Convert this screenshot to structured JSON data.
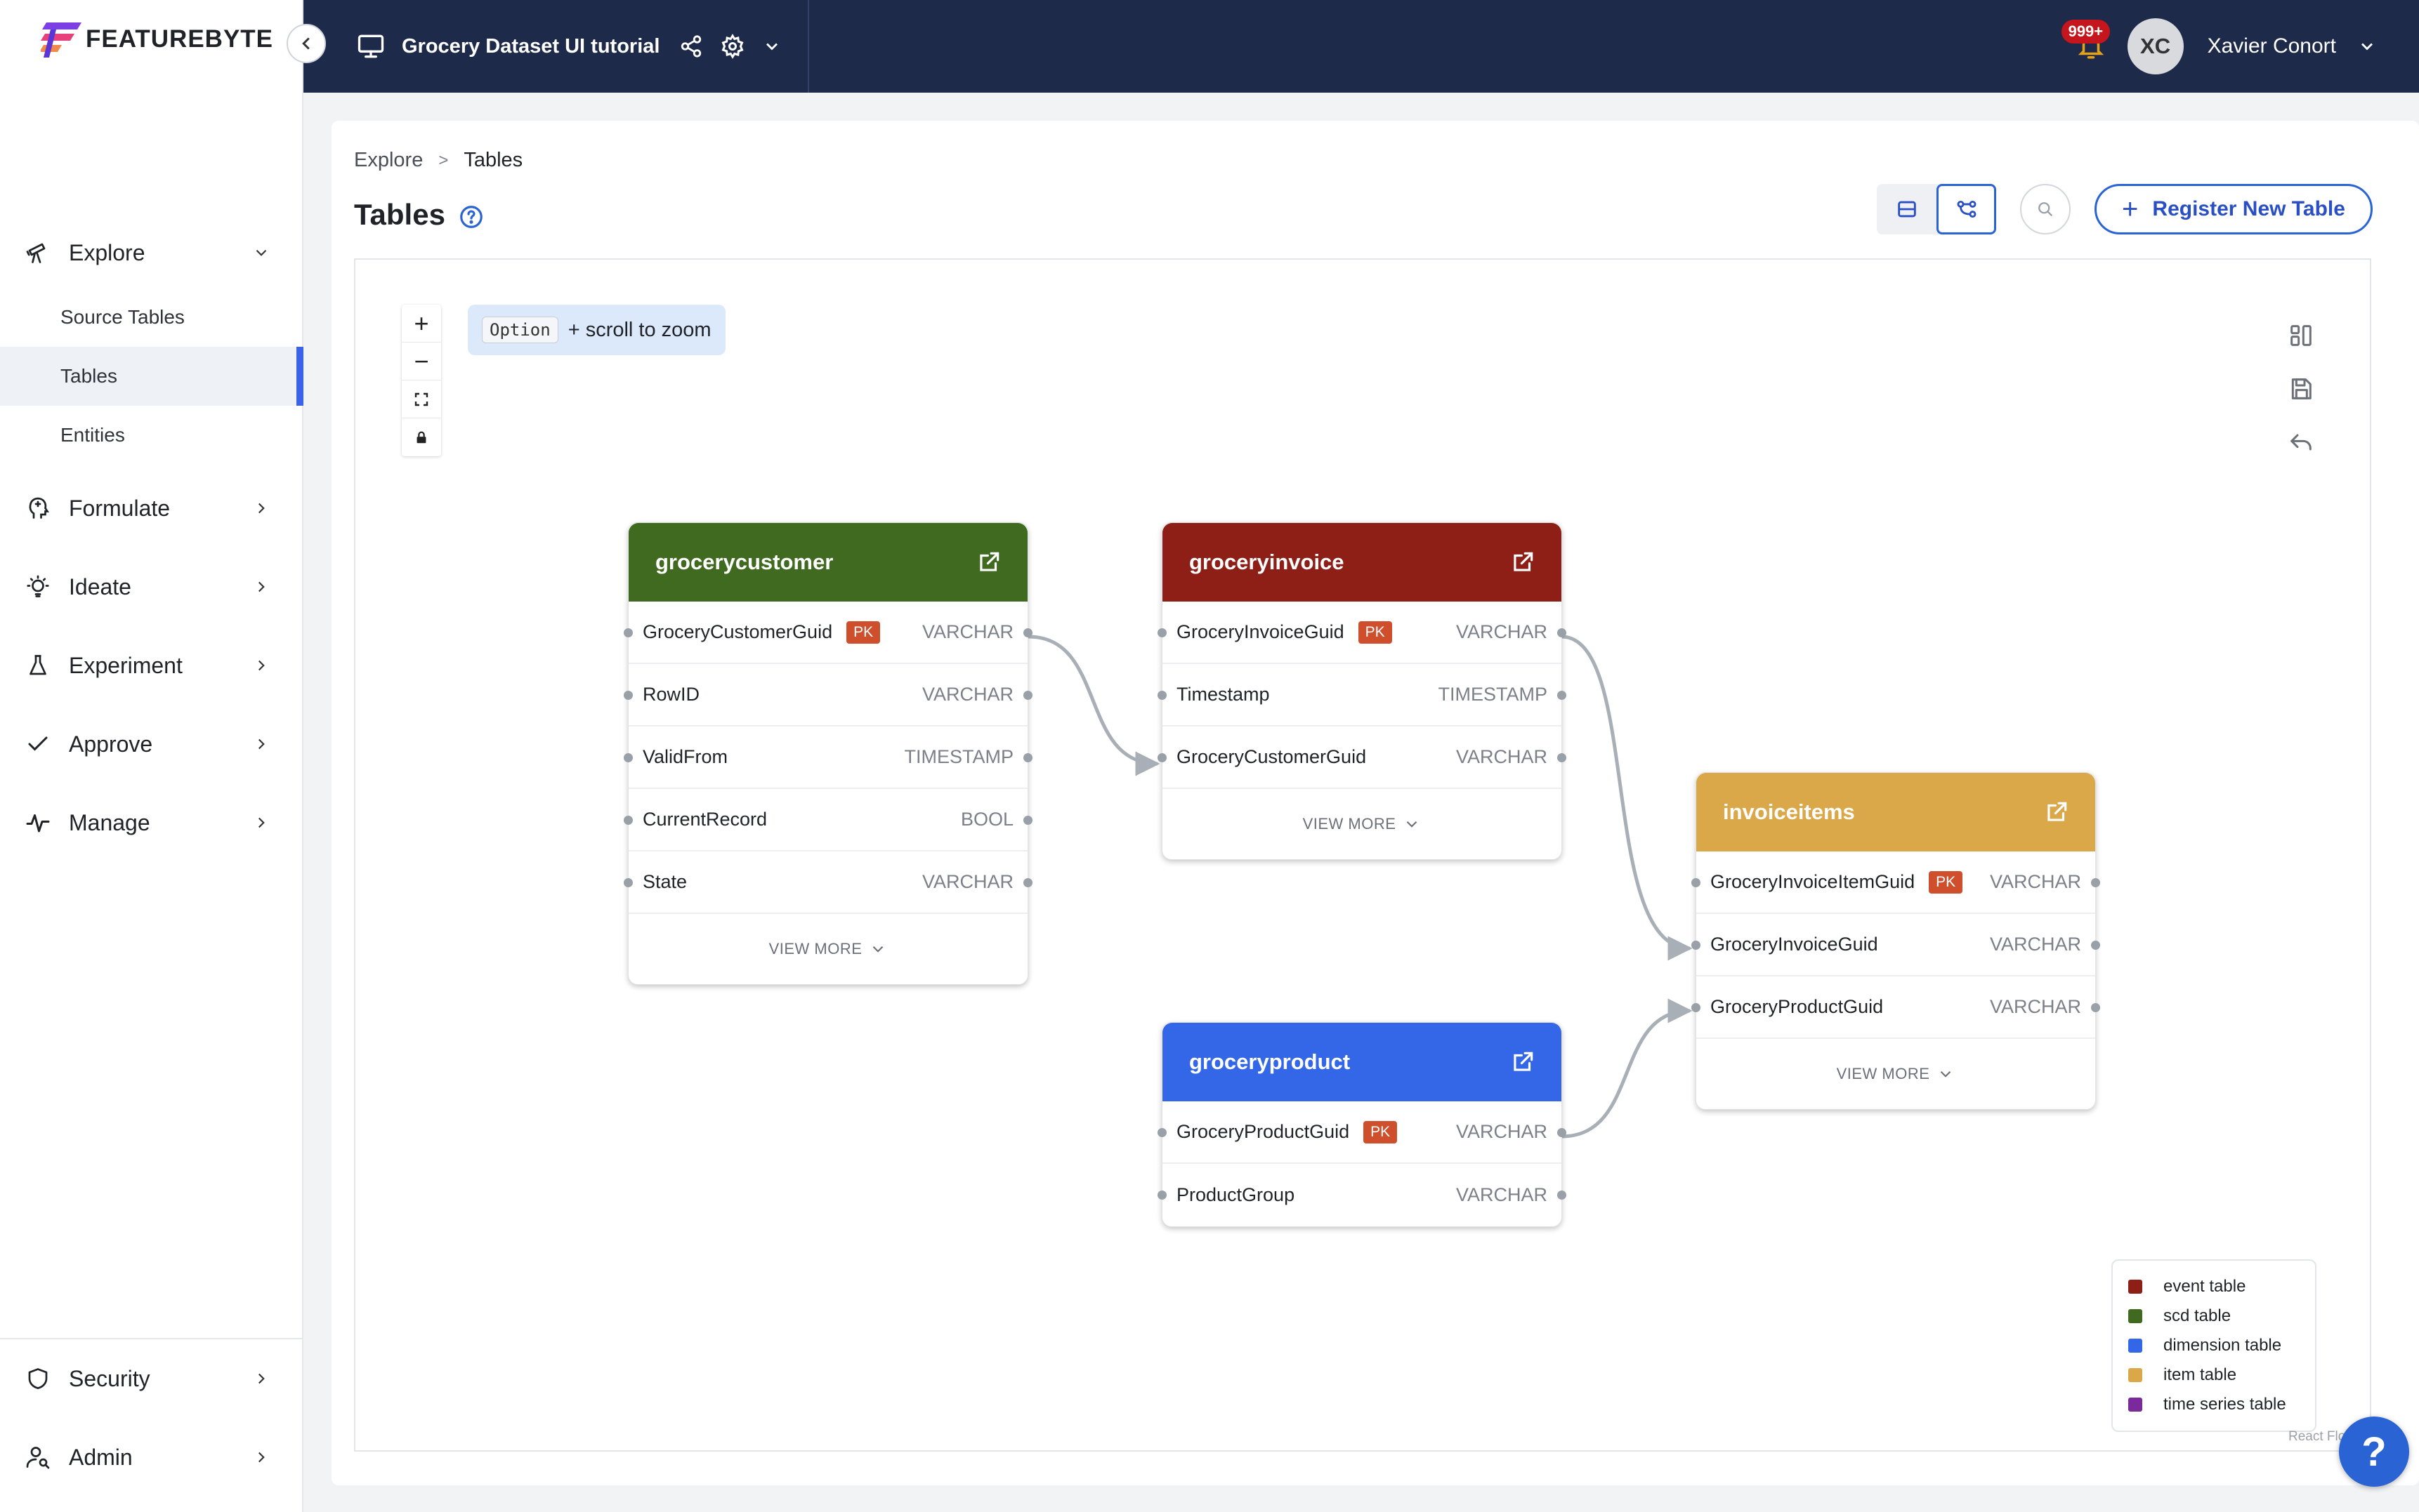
{
  "app": {
    "brand": "FEATUREBYTE"
  },
  "topbar": {
    "project_name": "Grocery Dataset UI tutorial",
    "notifications": "999+",
    "user_initials": "XC",
    "user_name": "Xavier Conort"
  },
  "sidebar": {
    "explore": "Explore",
    "explore_items": [
      "Source Tables",
      "Tables",
      "Entities"
    ],
    "formulate": "Formulate",
    "ideate": "Ideate",
    "experiment": "Experiment",
    "approve": "Approve",
    "manage": "Manage",
    "security": "Security",
    "admin": "Admin"
  },
  "breadcrumb": {
    "root": "Explore",
    "separator": ">",
    "current": "Tables"
  },
  "page": {
    "title": "Tables",
    "register_button": "Register New Table"
  },
  "canvas": {
    "zoom_hint_key": "Option",
    "zoom_hint_text": "+ scroll to zoom",
    "view_more": "VIEW MORE",
    "pk_label": "PK",
    "attribution": "React Flow"
  },
  "tables": [
    {
      "name": "grocerycustomer",
      "type": "scd table",
      "color": "#3f6a1f",
      "columns": [
        {
          "name": "GroceryCustomerGuid",
          "pk": true,
          "dtype": "VARCHAR"
        },
        {
          "name": "RowID",
          "pk": false,
          "dtype": "VARCHAR"
        },
        {
          "name": "ValidFrom",
          "pk": false,
          "dtype": "TIMESTAMP"
        },
        {
          "name": "CurrentRecord",
          "pk": false,
          "dtype": "BOOL"
        },
        {
          "name": "State",
          "pk": false,
          "dtype": "VARCHAR"
        }
      ]
    },
    {
      "name": "groceryinvoice",
      "type": "event table",
      "color": "#8e1f17",
      "columns": [
        {
          "name": "GroceryInvoiceGuid",
          "pk": true,
          "dtype": "VARCHAR"
        },
        {
          "name": "Timestamp",
          "pk": false,
          "dtype": "TIMESTAMP"
        },
        {
          "name": "GroceryCustomerGuid",
          "pk": false,
          "dtype": "VARCHAR"
        }
      ]
    },
    {
      "name": "invoiceitems",
      "type": "item table",
      "color": "#dba849",
      "columns": [
        {
          "name": "GroceryInvoiceItemGuid",
          "pk": true,
          "dtype": "VARCHAR"
        },
        {
          "name": "GroceryInvoiceGuid",
          "pk": false,
          "dtype": "VARCHAR"
        },
        {
          "name": "GroceryProductGuid",
          "pk": false,
          "dtype": "VARCHAR"
        }
      ]
    },
    {
      "name": "groceryproduct",
      "type": "dimension table",
      "color": "#3467e8",
      "columns": [
        {
          "name": "GroceryProductGuid",
          "pk": true,
          "dtype": "VARCHAR"
        },
        {
          "name": "ProductGroup",
          "pk": false,
          "dtype": "VARCHAR"
        }
      ]
    }
  ],
  "legend": [
    {
      "label": "event table",
      "color": "#8e1f17"
    },
    {
      "label": "scd table",
      "color": "#3f6a1f"
    },
    {
      "label": "dimension table",
      "color": "#3467e8"
    },
    {
      "label": "item table",
      "color": "#dba849"
    },
    {
      "label": "time series table",
      "color": "#7b2a9c"
    }
  ],
  "help_fab": "?"
}
